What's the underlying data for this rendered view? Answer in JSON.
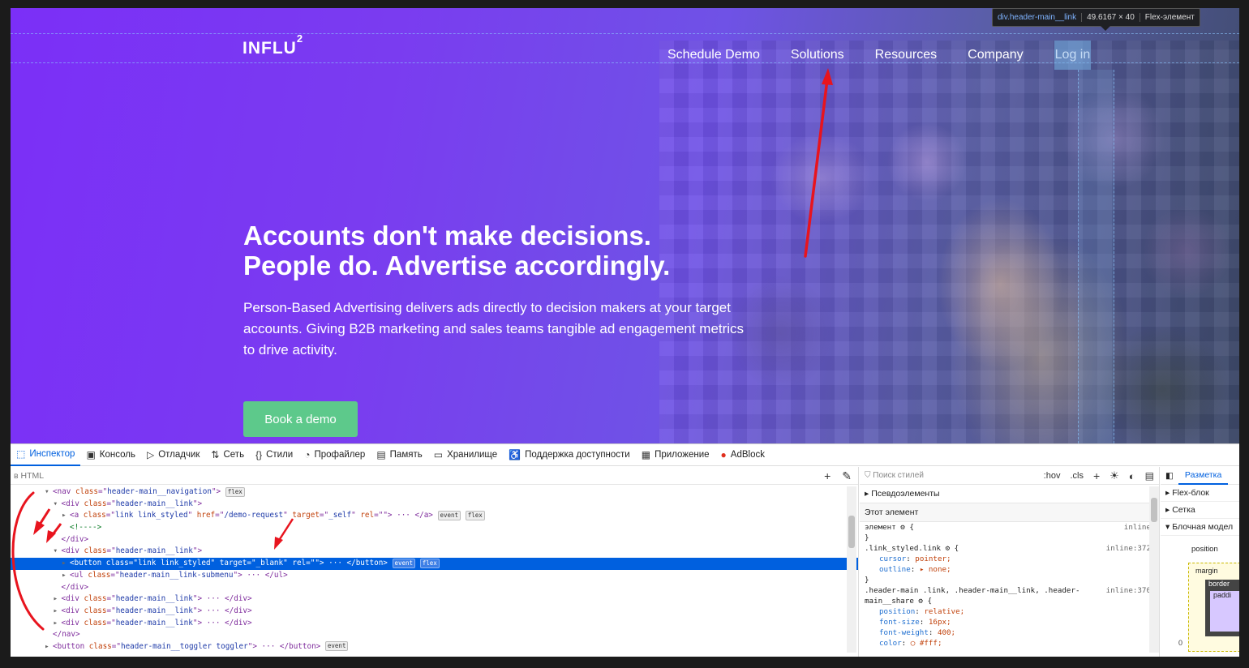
{
  "hero": {
    "logo": "INFLU",
    "logo_sup": "2",
    "nav": [
      "Schedule Demo",
      "Solutions",
      "Resources",
      "Company",
      "Log in"
    ],
    "headline_1": "Accounts don't make decisions.",
    "headline_2": "People do. Advertise accordingly.",
    "subtext": "Person-Based Advertising delivers ads directly to decision makers at your target accounts. Giving B2B marketing and sales teams tangible ad engagement metrics to drive activity.",
    "cta": "Book a demo",
    "tooltip": {
      "name": "div.header-main__link",
      "size": "49.6167 × 40",
      "kind": "Flex-элемент"
    }
  },
  "devtools": {
    "tabs": [
      {
        "icon": "inspector-icon",
        "glyph": "⬚",
        "label": "Инспектор"
      },
      {
        "icon": "console-icon",
        "glyph": "▣",
        "label": "Консоль"
      },
      {
        "icon": "debugger-icon",
        "glyph": "▷",
        "label": "Отладчик"
      },
      {
        "icon": "network-icon",
        "glyph": "⇅",
        "label": "Сеть"
      },
      {
        "icon": "style-editor-icon",
        "glyph": "{}",
        "label": "Стили"
      },
      {
        "icon": "profiler-icon",
        "glyph": "◔",
        "label": "Профайлер"
      },
      {
        "icon": "memory-icon",
        "glyph": "▤",
        "label": "Память"
      },
      {
        "icon": "storage-icon",
        "glyph": "▭",
        "label": "Хранилище"
      },
      {
        "icon": "accessibility-icon",
        "glyph": "♿",
        "label": "Поддержка доступности"
      },
      {
        "icon": "application-icon",
        "glyph": "▦",
        "label": "Приложение"
      },
      {
        "icon": "adblock-icon",
        "glyph": "●",
        "label": "AdBlock"
      }
    ],
    "html_search_placeholder": "в HTML",
    "styles_search_placeholder": "Поиск стилей",
    "styles_toggles": [
      ":hov",
      ".cls"
    ],
    "pseudo_label": "Псевдоэлементы",
    "this_element_label": "Этот элемент",
    "layout_tab": "Разметка",
    "layout_sections": [
      "Flex-блок",
      "Сетка",
      "Блочная модел"
    ],
    "box_labels": {
      "position": "position",
      "margin": "margin",
      "border": "border",
      "padding": "paddi",
      "zero": "0"
    }
  },
  "dom": [
    {
      "ind": 4,
      "tw": "▾",
      "parts": [
        [
          "tg",
          "<nav "
        ],
        [
          "at",
          "class"
        ],
        [
          "tg",
          "=\""
        ],
        [
          "av",
          "header-main__navigation"
        ],
        [
          "tg",
          "\">"
        ]
      ],
      "badges": [
        "flex"
      ]
    },
    {
      "ind": 5,
      "tw": "▾",
      "parts": [
        [
          "tg",
          "<div "
        ],
        [
          "at",
          "class"
        ],
        [
          "tg",
          "=\""
        ],
        [
          "av",
          "header-main__link"
        ],
        [
          "tg",
          "\">"
        ]
      ]
    },
    {
      "ind": 6,
      "tw": "▸",
      "parts": [
        [
          "tg",
          "<a "
        ],
        [
          "at",
          "class"
        ],
        [
          "tg",
          "=\""
        ],
        [
          "av",
          "link link_styled"
        ],
        [
          "tg",
          "\" "
        ],
        [
          "at",
          "href"
        ],
        [
          "tg",
          "=\""
        ],
        [
          "av",
          "/demo-request"
        ],
        [
          "tg",
          "\" "
        ],
        [
          "at",
          "target"
        ],
        [
          "tg",
          "=\""
        ],
        [
          "av",
          "_self"
        ],
        [
          "tg",
          "\" "
        ],
        [
          "at",
          "rel"
        ],
        [
          "tg",
          "=\"\">"
        ],
        [
          "tg",
          " ··· </a>"
        ]
      ],
      "badges": [
        "event",
        "flex"
      ]
    },
    {
      "ind": 6,
      "tw": " ",
      "parts": [
        [
          "cm",
          "<!---->"
        ]
      ]
    },
    {
      "ind": 5,
      "tw": " ",
      "parts": [
        [
          "tg",
          "</div>"
        ]
      ]
    },
    {
      "ind": 5,
      "tw": "▾",
      "parts": [
        [
          "tg",
          "<div "
        ],
        [
          "at",
          "class"
        ],
        [
          "tg",
          "=\""
        ],
        [
          "av",
          "header-main__link"
        ],
        [
          "tg",
          "\">"
        ]
      ]
    },
    {
      "ind": 6,
      "tw": "▸",
      "sel": true,
      "parts": [
        [
          "tg",
          "<button "
        ],
        [
          "at",
          "class"
        ],
        [
          "tg",
          "=\""
        ],
        [
          "av",
          "link link_styled"
        ],
        [
          "tg",
          "\" "
        ],
        [
          "at",
          "target"
        ],
        [
          "tg",
          "=\""
        ],
        [
          "av",
          "_blank"
        ],
        [
          "tg",
          "\" "
        ],
        [
          "at",
          "rel"
        ],
        [
          "tg",
          "=\"\"> ··· </button>"
        ]
      ],
      "badges": [
        "event",
        "flex"
      ]
    },
    {
      "ind": 6,
      "tw": "▸",
      "parts": [
        [
          "tg",
          "<ul "
        ],
        [
          "at",
          "class"
        ],
        [
          "tg",
          "=\""
        ],
        [
          "av",
          "header-main__link-submenu"
        ],
        [
          "tg",
          "\"> ··· </ul>"
        ]
      ]
    },
    {
      "ind": 5,
      "tw": " ",
      "parts": [
        [
          "tg",
          "</div>"
        ]
      ]
    },
    {
      "ind": 5,
      "tw": "▸",
      "parts": [
        [
          "tg",
          "<div "
        ],
        [
          "at",
          "class"
        ],
        [
          "tg",
          "=\""
        ],
        [
          "av",
          "header-main__link"
        ],
        [
          "tg",
          "\"> ··· </div>"
        ]
      ]
    },
    {
      "ind": 5,
      "tw": "▸",
      "parts": [
        [
          "tg",
          "<div "
        ],
        [
          "at",
          "class"
        ],
        [
          "tg",
          "=\""
        ],
        [
          "av",
          "header-main__link"
        ],
        [
          "tg",
          "\"> ··· </div>"
        ]
      ]
    },
    {
      "ind": 5,
      "tw": "▸",
      "parts": [
        [
          "tg",
          "<div "
        ],
        [
          "at",
          "class"
        ],
        [
          "tg",
          "=\""
        ],
        [
          "av",
          "header-main__link"
        ],
        [
          "tg",
          "\"> ··· </div>"
        ]
      ]
    },
    {
      "ind": 4,
      "tw": " ",
      "parts": [
        [
          "tg",
          "</nav>"
        ]
      ]
    },
    {
      "ind": 4,
      "tw": "▸",
      "parts": [
        [
          "tg",
          "<button "
        ],
        [
          "at",
          "class"
        ],
        [
          "tg",
          "=\""
        ],
        [
          "av",
          "header-main__toggler toggler"
        ],
        [
          "tg",
          "\"> ··· </button>"
        ]
      ],
      "badges": [
        "event"
      ]
    }
  ],
  "css": [
    {
      "t": "элемент ⚙ {",
      "src": "inline"
    },
    {
      "t": "}"
    },
    {
      "t": ".link_styled.link ⚙ {",
      "src": "inline:372"
    },
    {
      "p": "cursor",
      "v": "pointer;"
    },
    {
      "p": "outline",
      "v": "▸ none;"
    },
    {
      "t": "}"
    },
    {
      "t": ".header-main .link, .header-main__link, .header-",
      "src": "inline:370"
    },
    {
      "t": "main__share ⚙ {"
    },
    {
      "p": "position",
      "v": "relative;"
    },
    {
      "p": "font-size",
      "v": "16px;"
    },
    {
      "p": "font-weight",
      "v": "400;"
    },
    {
      "p": "color",
      "v": "◯ #fff;"
    }
  ]
}
